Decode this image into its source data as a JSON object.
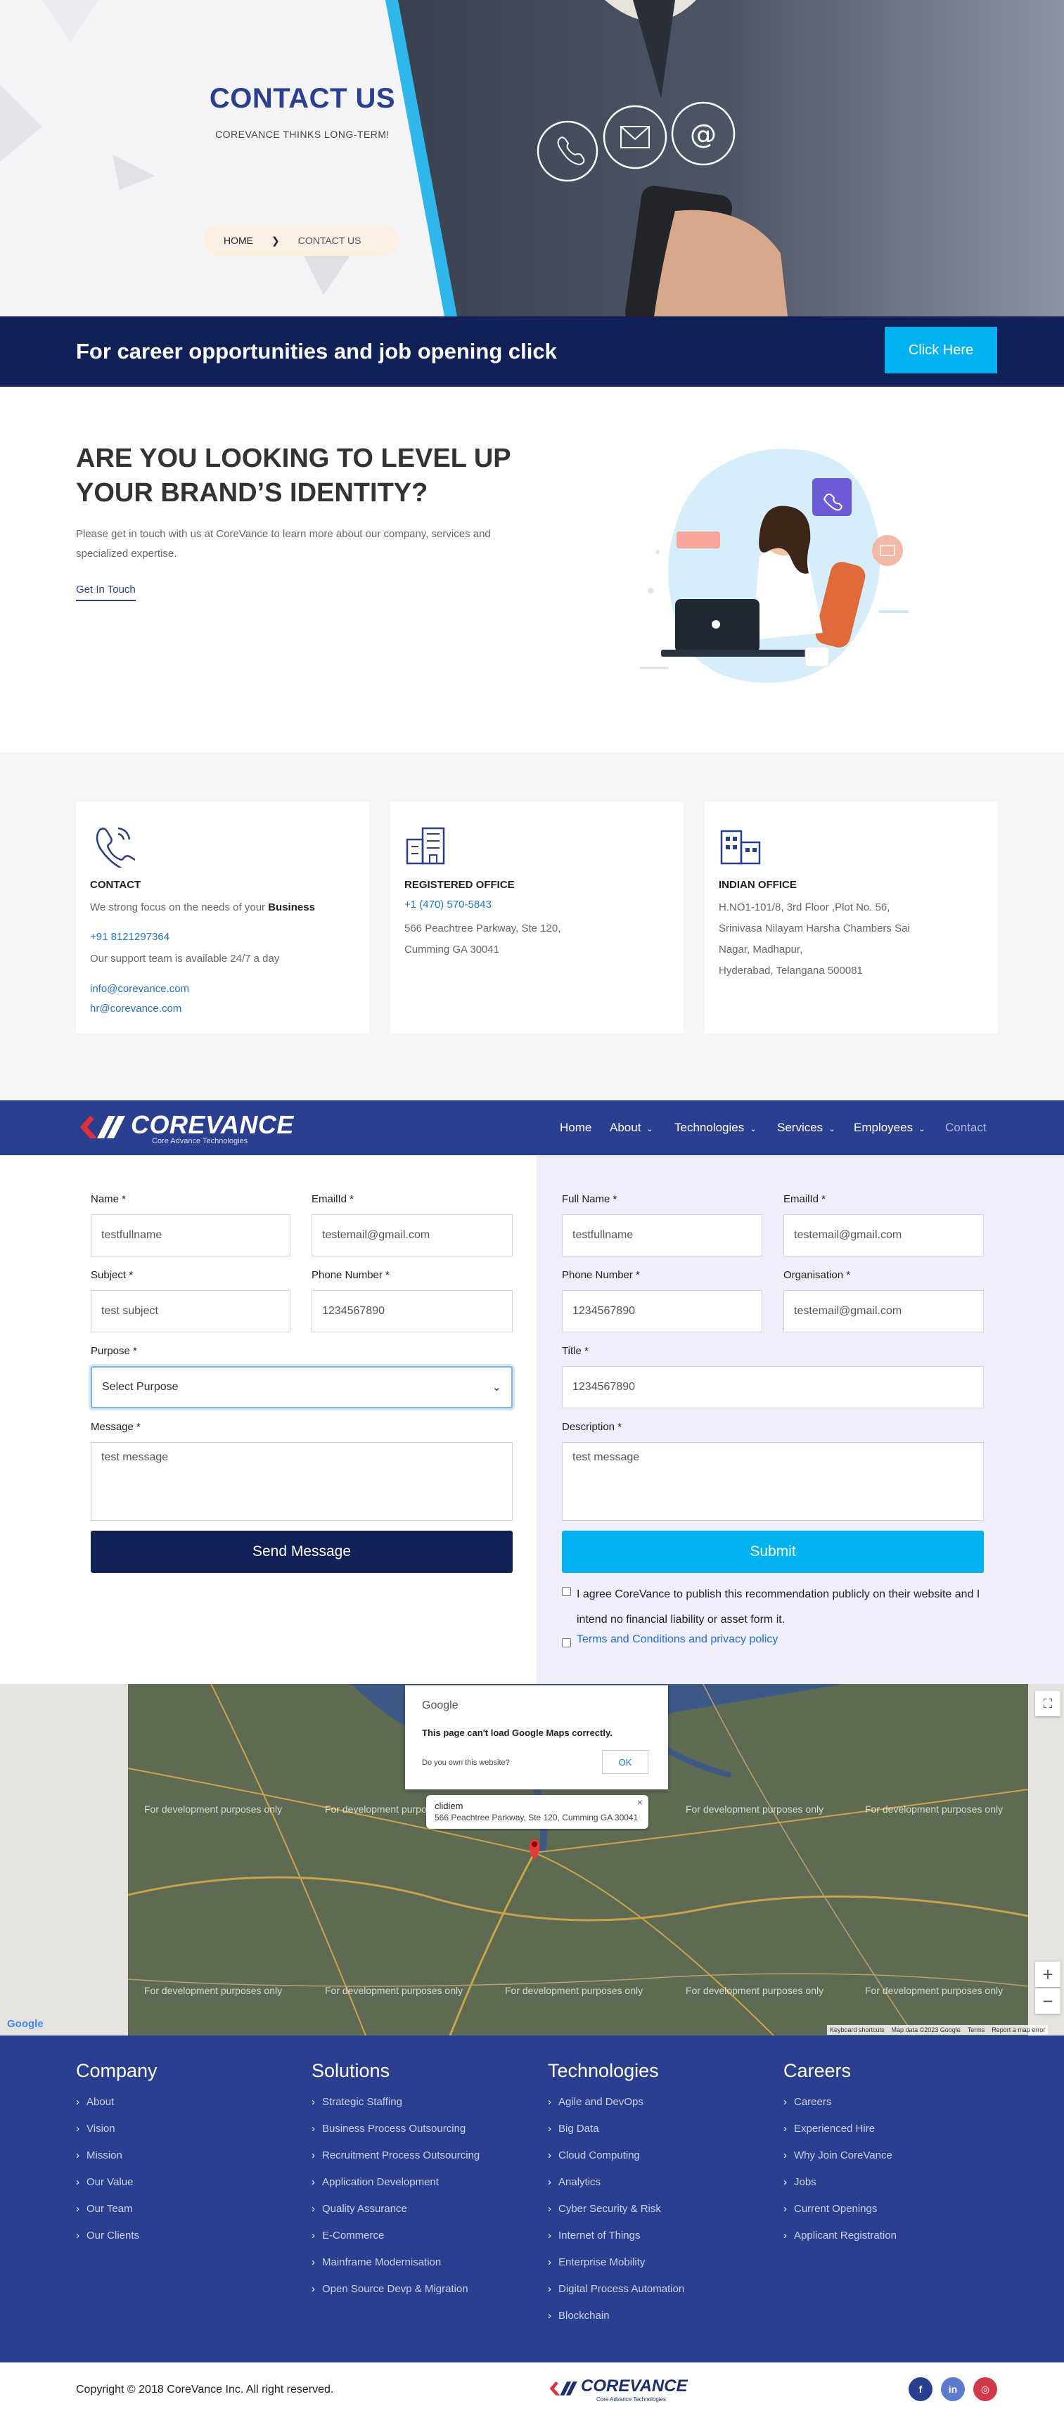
{
  "hero": {
    "title": "CONTACT US",
    "subtitle": "COREVANCE THINKS LONG-TERM!",
    "breadcrumb": {
      "home": "HOME",
      "separator": "❯",
      "current": "CONTACT US"
    }
  },
  "career": {
    "text": "For career opportunities and job opening click",
    "button": "Click Here"
  },
  "levelup": {
    "heading": "ARE YOU LOOKING TO LEVEL UP YOUR BRAND’S IDENTITY?",
    "paragraph": "Please get in touch with us at CoreVance to learn more about our company, services and specialized expertise.",
    "link": "Get In Touch"
  },
  "cards": {
    "contact": {
      "title": "CONTACT",
      "focus_text": "We strong focus on the needs of your ",
      "focus_bold": "Business",
      "phone": "+91 8121297364",
      "support": "Our support team is available 24/7 a day",
      "email1": "info@corevance.com",
      "email2": "hr@corevance.com"
    },
    "registered": {
      "title": "REGISTERED OFFICE",
      "phone": "+1 (470) 570-5843",
      "addr1": "566 Peachtree Parkway, Ste 120,",
      "addr2": "Cumming GA 30041"
    },
    "indian": {
      "title": "INDIAN OFFICE",
      "addr1": "H.NO1-101/8, 3rd Floor ,Plot No. 56,",
      "addr2": "Srinivasa Nilayam Harsha Chambers Sai",
      "addr3": "Nagar, Madhapur,",
      "addr4": "Hyderabad, Telangana 500081"
    }
  },
  "nav": {
    "logo_word": "COREVANCE",
    "logo_tag": "Core Advance Technologies",
    "items": {
      "home": "Home",
      "about": "About",
      "technologies": "Technologies",
      "services": "Services",
      "employees": "Employees",
      "contact": "Contact"
    },
    "caret": "⌄"
  },
  "form_left": {
    "name_label": "Name *",
    "name_value": "testfullname",
    "email_label": "EmailId *",
    "email_value": "testemail@gmail.com",
    "subject_label": "Subject *",
    "subject_value": "test subject",
    "phone_label": "Phone Number *",
    "phone_value": "1234567890",
    "purpose_label": "Purpose *",
    "purpose_value": "Select Purpose",
    "message_label": "Message *",
    "message_value": "test message",
    "send": "Send Message"
  },
  "form_right": {
    "fullname_label": "Full Name *",
    "fullname_value": "testfullname",
    "email_label": "EmailId *",
    "email_value": "testemail@gmail.com",
    "phone_label": "Phone Number *",
    "phone_value": "1234567890",
    "org_label": "Organisation *",
    "org_value": "testemail@gmail.com",
    "title_label": "Title *",
    "title_value": "1234567890",
    "desc_label": "Description *",
    "desc_value": "test message",
    "submit": "Submit",
    "agree": "I agree CoreVance to publish this recommendation publicly on their website and I intend no financial liability or asset form it.",
    "terms": "Terms and Conditions and privacy policy"
  },
  "map": {
    "dialog_logo": "Google",
    "dialog_message": "This page can't load Google Maps correctly.",
    "dialog_question": "Do you own this website?",
    "dialog_ok": "OK",
    "info_name": "clidiem",
    "info_addr": "566 Peachtree Parkway, Ste 120, Cumming GA 30041",
    "info_close": "×",
    "dev_text": "For development purposes only",
    "google": "Google",
    "footer_shortcuts": "Keyboard shortcuts",
    "footer_data": "Map data ©2023 Google",
    "footer_terms": "Terms",
    "footer_report": "Report a map error",
    "fullscreen": "⛶",
    "zoom_in": "+",
    "zoom_out": "−"
  },
  "footer": {
    "company": {
      "heading": "Company",
      "items": [
        "About",
        "Vision",
        "Mission",
        "Our Value",
        "Our Team",
        "Our Clients"
      ]
    },
    "solutions": {
      "heading": "Solutions",
      "items": [
        "Strategic Staffing",
        "Business Process Outsourcing",
        "Recruitment Process Outsourcing",
        "Application Development",
        "Quality Assurance",
        "E-Commerce",
        "Mainframe Modernisation",
        "Open Source Devp & Migration"
      ]
    },
    "technologies": {
      "heading": "Technologies",
      "items": [
        "Agile and DevOps",
        "Big Data",
        "Cloud Computing",
        "Analytics",
        "Cyber Security & Risk",
        "Internet of Things",
        "Enterprise Mobility",
        "Digital Process Automation",
        "Blockchain"
      ]
    },
    "careers": {
      "heading": "Careers",
      "items": [
        "Careers",
        "Experienced Hire",
        "Why Join CoreVance",
        "Jobs",
        "Current Openings",
        "Applicant Registration"
      ]
    }
  },
  "bottom": {
    "copyright": "Copyright © 2018 CoreVance Inc. All right reserved.",
    "logo_word": "COREVANCE",
    "logo_tag": "Core Advance Technologies",
    "social": {
      "facebook": "f",
      "linkedin": "in",
      "instagram": "◎"
    }
  },
  "colors": {
    "navy": "#0f2156",
    "brand_blue": "#2a3f8f",
    "cyan": "#00b3f0",
    "link_blue": "#1f6fd6",
    "logo_red": "#e0303a"
  }
}
